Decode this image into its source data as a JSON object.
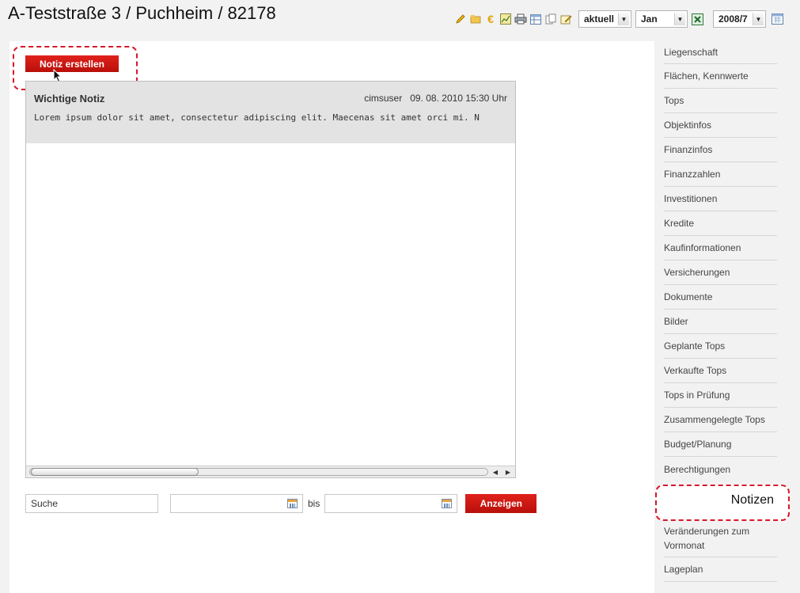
{
  "header": {
    "title": "A-Teststraße 3 / Puchheim / 82178"
  },
  "toolbar": {
    "icons": [
      "pencil-icon",
      "folder-icon",
      "euro-icon",
      "chart-icon",
      "print-icon",
      "table-icon",
      "copy-icon",
      "edit-note-icon",
      "excel-icon",
      "calendar-icon"
    ],
    "status_select": "aktuell",
    "month_select": "Jan",
    "period_select": "2008/7"
  },
  "main": {
    "new_note_label": "Notiz erstellen",
    "note": {
      "title": "Wichtige Notiz",
      "user": "cimsuser",
      "date": "09. 08. 2010 15:30 Uhr",
      "body": "Lorem ipsum dolor sit amet, consectetur adipiscing elit. Maecenas sit amet orci mi. N"
    },
    "filter": {
      "search_value": "Suche",
      "from_value": "",
      "bis_label": "bis",
      "to_value": "",
      "show_label": "Anzeigen"
    }
  },
  "sidebar": {
    "items": [
      {
        "label": "Liegenschaft"
      },
      {
        "label": "Flächen, Kennwerte"
      },
      {
        "label": "Tops"
      },
      {
        "label": "Objektinfos"
      },
      {
        "label": "Finanzinfos"
      },
      {
        "label": "Finanzzahlen"
      },
      {
        "label": "Investitionen"
      },
      {
        "label": "Kredite"
      },
      {
        "label": "Kaufinformationen"
      },
      {
        "label": "Versicherungen"
      },
      {
        "label": "Dokumente"
      },
      {
        "label": "Bilder"
      },
      {
        "label": "Geplante Tops"
      },
      {
        "label": "Verkaufte Tops"
      },
      {
        "label": "Tops in Prüfung"
      },
      {
        "label": "Zusammengelegte Tops"
      },
      {
        "label": "Budget/Planung"
      },
      {
        "label": "Berechtigungen"
      },
      {
        "label": "Notizen"
      },
      {
        "label": "Veränderungen zum Vormonat"
      },
      {
        "label": "Lageplan"
      }
    ]
  },
  "colors": {
    "accent_red": "#c8150f",
    "highlight": "#d8182a"
  }
}
